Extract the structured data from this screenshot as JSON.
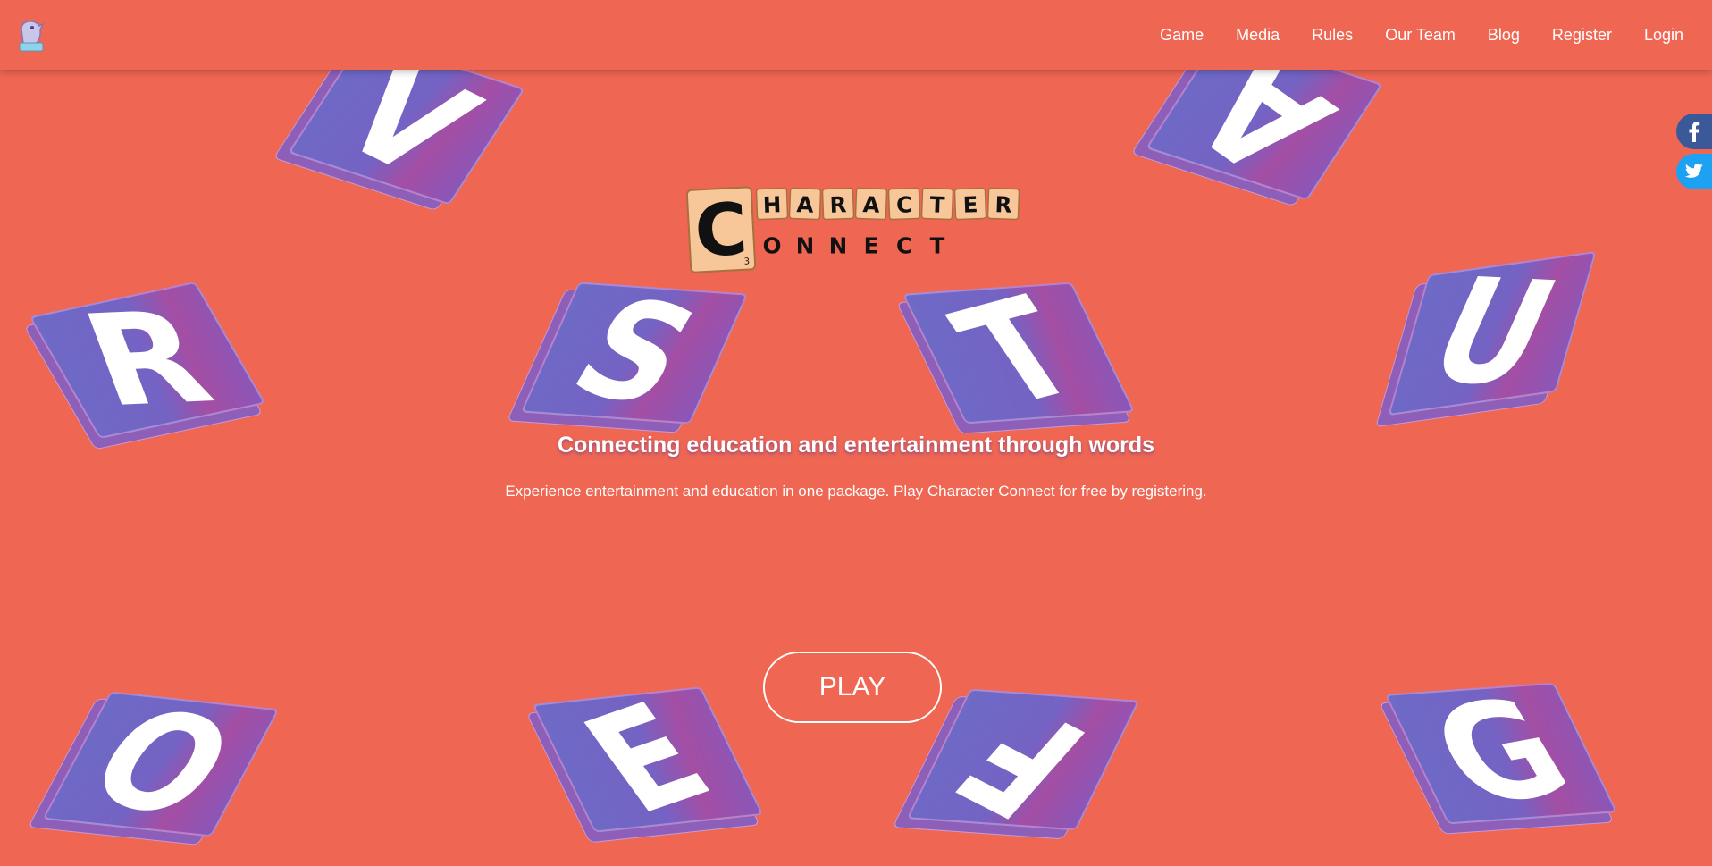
{
  "navbar": {
    "logo_icon": "bird-logo-icon",
    "links": [
      "Game",
      "Media",
      "Rules",
      "Our Team",
      "Blog",
      "Register",
      "Login"
    ]
  },
  "social": {
    "facebook_icon": "facebook-icon",
    "twitter_icon": "twitter-icon"
  },
  "hero": {
    "logo": {
      "line1_big": "C",
      "line1_rest": [
        "H",
        "A",
        "R",
        "A",
        "C",
        "T",
        "E",
        "R"
      ],
      "line2_rest": [
        "O",
        "N",
        "N",
        "E",
        "C",
        "T"
      ],
      "big_tile_number": "3"
    },
    "headline": "Connecting education and entertainment through words",
    "subtext": "Experience entertainment and education in one package. Play Character Connect for free by registering.",
    "play_button": "PLAY"
  },
  "background_tiles": [
    "V",
    "A",
    "R",
    "S",
    "T",
    "U",
    "O",
    "E",
    "F",
    "G"
  ],
  "colors": {
    "background": "#ef6653",
    "tile_purple": "#6e6ac6",
    "tile_magenta": "#a44ea4",
    "logo_tile": "#f7c79a",
    "facebook": "#3b5998",
    "twitter": "#1da1f2"
  }
}
